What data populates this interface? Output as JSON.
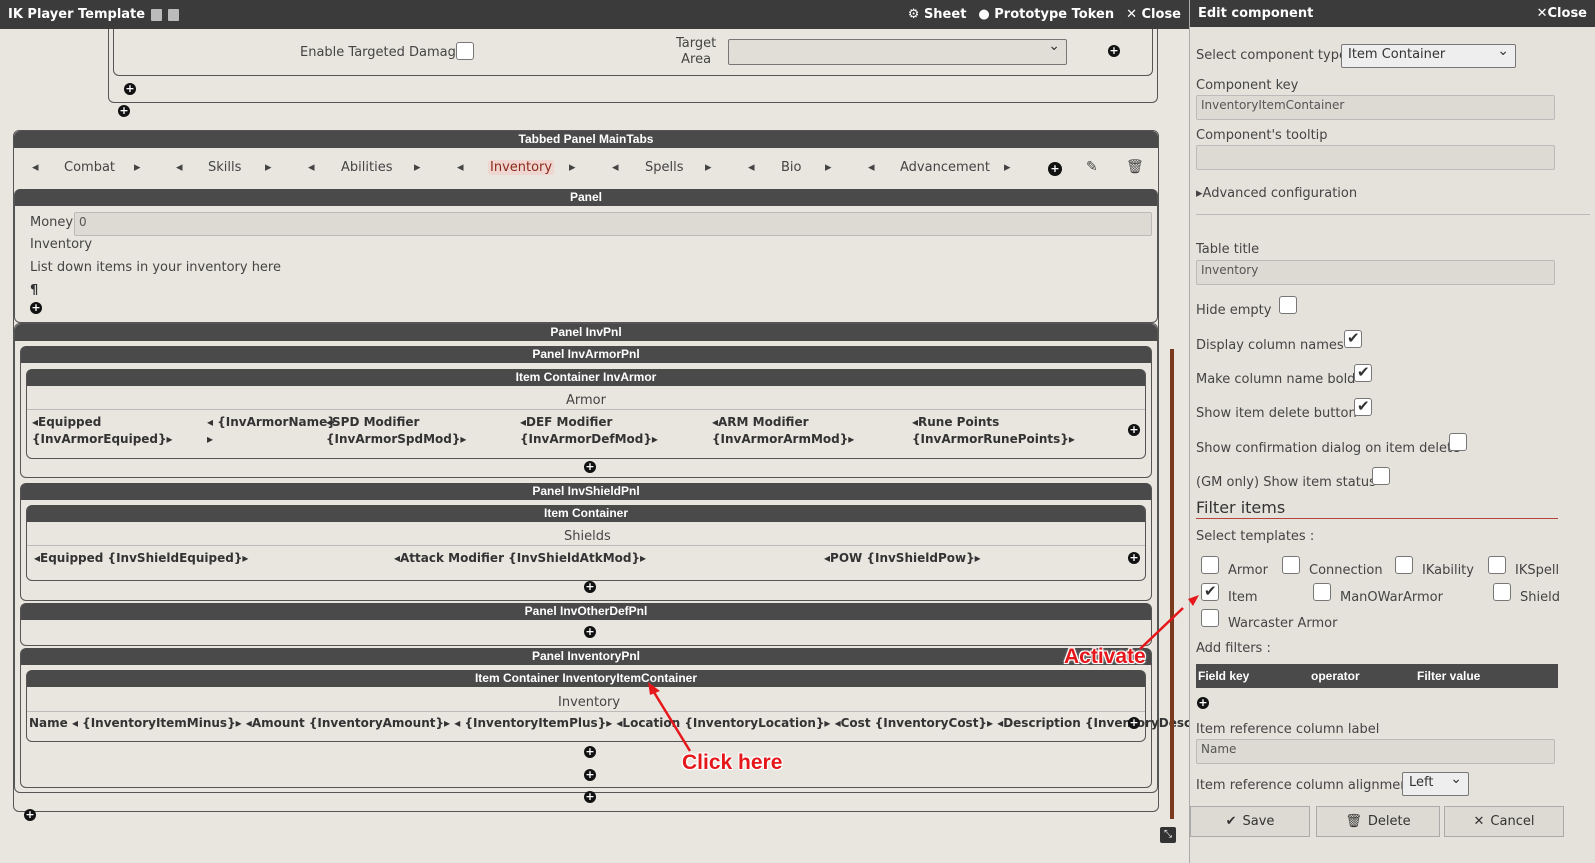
{
  "titlebar": {
    "title": "IK Player Template",
    "sheet": "Sheet",
    "prototype": "Prototype Token",
    "close": "Close"
  },
  "top": {
    "enable_targeted": "Enable Targeted Damage",
    "target_area": "Target\nArea"
  },
  "tabbed": {
    "header": "Tabbed Panel MainTabs",
    "tabs": [
      "Combat",
      "Skills",
      "Abilities",
      "Inventory",
      "Spells",
      "Bio",
      "Advancement"
    ],
    "active": "Inventory"
  },
  "panel1": {
    "header": "Panel",
    "money_label": "Money",
    "money_value": "0",
    "inventory": "Inventory",
    "desc": "List down items in your inventory here",
    "pilcrow": "¶"
  },
  "invpnl": {
    "header": "Panel InvPnl"
  },
  "armor": {
    "panel": "Panel InvArmorPnl",
    "container": "Item Container InvArmor",
    "title": "Armor",
    "cols": [
      "◂Equipped\n{InvArmorEquiped}▸",
      "◂ {InvArmorName}\n▸",
      "◂SPD Modifier\n{InvArmorSpdMod}▸",
      "◂DEF Modifier\n{InvArmorDefMod}▸",
      "◂ARM Modifier\n{InvArmorArmMod}▸",
      "◂Rune Points\n{InvArmorRunePoints}▸"
    ]
  },
  "shield": {
    "panel": "Panel InvShieldPnl",
    "container": "Item Container",
    "title": "Shields",
    "cols": [
      "◂Equipped {InvShieldEquiped}▸",
      "◂Attack Modifier {InvShieldAtkMod}▸",
      "◂POW {InvShieldPow}▸"
    ]
  },
  "otherdef": {
    "panel": "Panel InvOtherDefPnl"
  },
  "inventory": {
    "panel": "Panel InventoryPnl",
    "container": "Item Container InventoryItemContainer",
    "title": "Inventory",
    "row": "Name ◂ {InventoryItemMinus}▸ ◂Amount {InventoryAmount}▸ ◂ {InventoryItemPlus}▸ ◂Location {InventoryLocation}▸ ◂Cost {InventoryCost}▸ ◂Description {InventoryDescription}▸"
  },
  "annotations": {
    "click": "Click here",
    "activate": "Activate"
  },
  "edit": {
    "title": "Edit component",
    "close": "Close",
    "type_label": "Select component type",
    "type_value": "Item Container",
    "key_label": "Component key",
    "key_value": "InventoryItemContainer",
    "tooltip_label": "Component's tooltip",
    "tooltip_value": "",
    "advanced": "Advanced configuration",
    "table_title_label": "Table title",
    "table_title_value": "Inventory",
    "hide_empty": "Hide empty",
    "display_cols": "Display column names",
    "bold_cols": "Make column name bold",
    "show_delete": "Show item delete button",
    "confirm_delete": "Show confirmation dialog on item delete",
    "gm_status": "(GM only) Show item status",
    "filter_title": "Filter items",
    "select_templates": "Select templates :",
    "templates": [
      "Armor",
      "Connection",
      "IKability",
      "IKSpell",
      "Item",
      "ManOWarArmor",
      "Shield",
      "Warcaster Armor"
    ],
    "add_filters": "Add filters :",
    "filter_cols": [
      "Field key",
      "operator",
      "Filter value"
    ],
    "ref_label": "Item reference column label",
    "ref_value": "Name",
    "align_label": "Item reference column alignment",
    "align_value": "Left",
    "save": "Save",
    "delete": "Delete",
    "cancel": "Cancel"
  },
  "colors": {
    "accent": "#8b2a1a",
    "annotation": "#e5171b",
    "header": "#4a4a4a"
  }
}
